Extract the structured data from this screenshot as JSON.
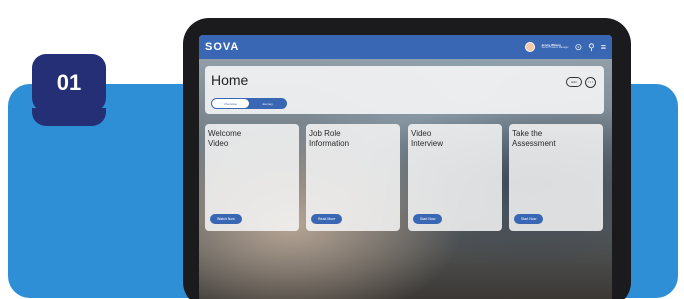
{
  "step": {
    "number": "01"
  },
  "app": {
    "logo": "SOVA",
    "user": {
      "name": "Jenny Wilson",
      "subtitle": "Senior Product Manager"
    },
    "icons": [
      "avatar",
      "compass-icon",
      "search-icon",
      "menu-icon"
    ]
  },
  "home": {
    "title": "Home",
    "tabs": [
      {
        "label": "Overview",
        "active": true
      },
      {
        "label": "Journey",
        "active": false
      }
    ],
    "actions": {
      "edit_label": "Edit",
      "more_label": "⋯"
    }
  },
  "cards": [
    {
      "title_line1": "Welcome",
      "title_line2": "Video",
      "button": "Watch Now"
    },
    {
      "title_line1": "Job Role",
      "title_line2": "Information",
      "button": "Read More"
    },
    {
      "title_line1": "Video",
      "title_line2": "Interview",
      "button": "Start Now"
    },
    {
      "title_line1": "Take the",
      "title_line2": "Assessment",
      "button": "Start Now"
    }
  ],
  "colors": {
    "band": "#2f8fd6",
    "badge": "#242f75",
    "app_bar": "#3a67b4",
    "tablet": "#1b1b1d"
  }
}
